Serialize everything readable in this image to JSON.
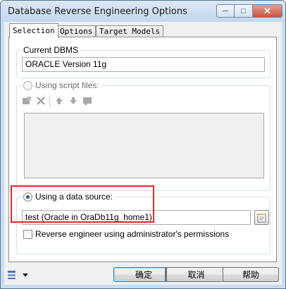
{
  "window": {
    "title": "Database Reverse Engineering Options",
    "min_glyph": "─",
    "max_glyph": "□",
    "close_glyph": "✕"
  },
  "tabs": [
    {
      "label": "Selection",
      "active": true
    },
    {
      "label": "Options",
      "active": false
    },
    {
      "label": "Target Models",
      "active": false
    }
  ],
  "current_dbms": {
    "legend": "Current DBMS",
    "value": "ORACLE Version 11g"
  },
  "script_files": {
    "label": "Using script files:",
    "selected": false,
    "toolbar_icons": [
      "add-file-icon",
      "delete-icon",
      "move-up-icon",
      "move-down-icon",
      "folder-icon"
    ]
  },
  "data_source": {
    "label": "Using a data source:",
    "selected": true,
    "value": "test (Oracle in OraDb11g_home1)",
    "admin_checkbox_label": "Reverse engineer using administrator's permissions",
    "admin_checked": false
  },
  "buttons": {
    "ok": "确定",
    "cancel": "取消",
    "help": "帮助"
  },
  "colors": {
    "highlight": "#e22a2a",
    "title_bar": "#c9dcf1"
  }
}
